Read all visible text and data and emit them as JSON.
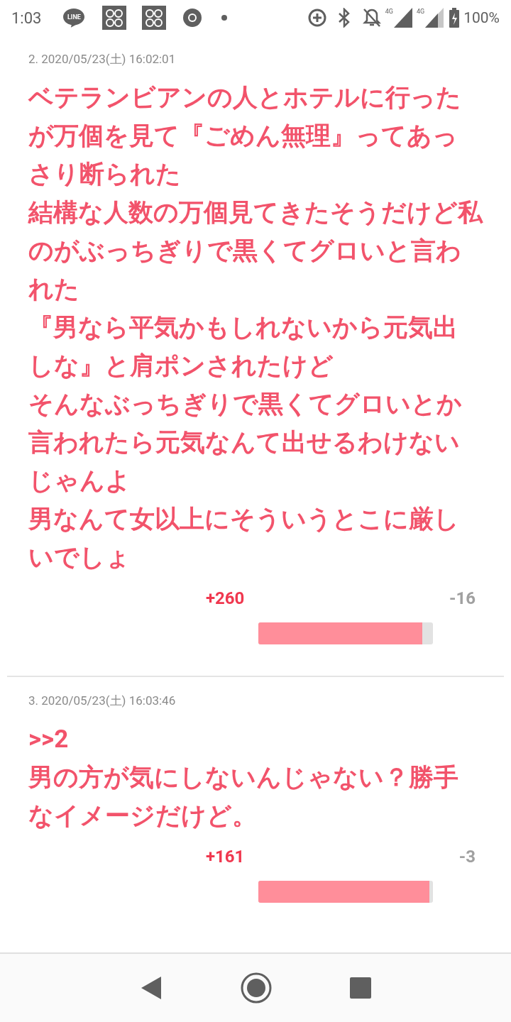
{
  "status_bar": {
    "time": "1:03",
    "notification_label": "LINE",
    "network_labels": [
      "4G",
      "4G"
    ],
    "battery": "100%"
  },
  "comments": [
    {
      "header": "2. 2020/05/23(土) 16:02:01",
      "lines": [
        "ベテランビアンの人とホテルに行ったが万個を見て『ごめん無理』ってあっさり断られた",
        "結構な人数の万個見てきたそうだけど私のがぶっちぎりで黒くてグロいと言われた",
        "『男なら平気かもしれないから元気出しな』と肩ポンされたけど",
        "そんなぶっちぎりで黒くてグロいとか言われたら元気なんて出せるわけないじゃんよ",
        "男なんて女以上にそういうとこに厳しいでしょ"
      ],
      "plus": "+260",
      "minus": "-16",
      "level": 0.94
    },
    {
      "header": "3. 2020/05/23(土) 16:03:46",
      "lines": [
        ">>2",
        "男の方が気にしないんじゃない？勝手なイメージだけど。"
      ],
      "plus": "+161",
      "minus": "-3",
      "level": 0.98
    }
  ]
}
